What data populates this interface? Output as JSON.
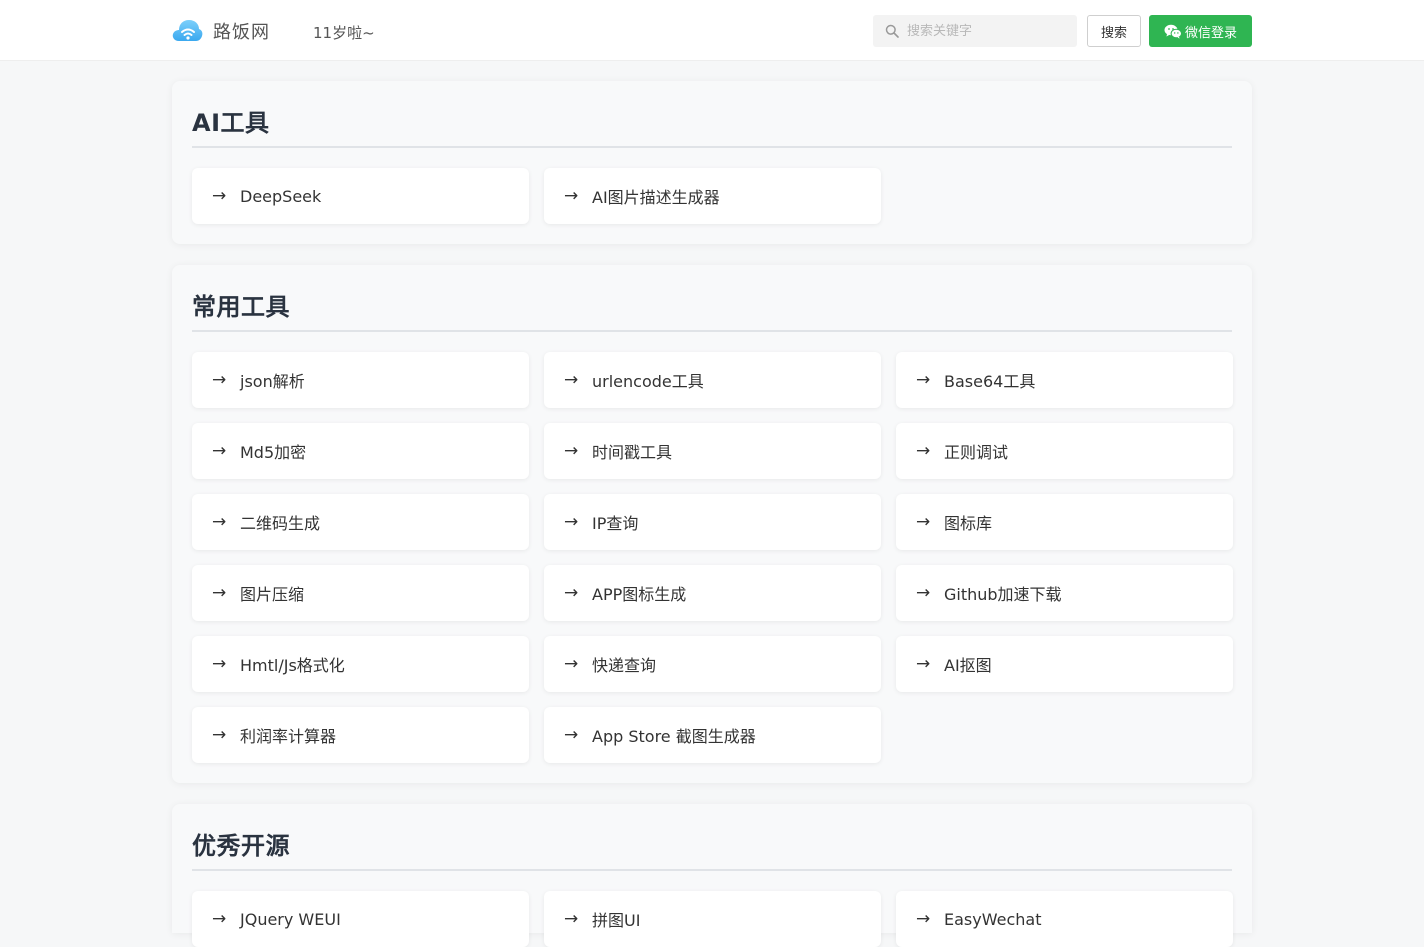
{
  "header": {
    "logo_text": "路饭网",
    "tagline": "11岁啦~",
    "search": {
      "placeholder": "搜索关键字",
      "value": ""
    },
    "search_button": "搜索",
    "login_button": "微信登录"
  },
  "colors": {
    "accent_green": "#2fb552",
    "logo_blue": "#4fb6f5",
    "page_bg": "#f6f7f8",
    "card_bg": "#ffffff",
    "heading": "#2a3340"
  },
  "icons": {
    "logo": "cloud-wifi-icon",
    "search": "search-icon",
    "login": "wechat-icon",
    "card": "arrow-right-icon"
  },
  "sections": [
    {
      "title": "AI工具",
      "items": [
        "DeepSeek",
        "AI图片描述生成器"
      ]
    },
    {
      "title": "常用工具",
      "items": [
        "json解析",
        "urlencode工具",
        "Base64工具",
        "Md5加密",
        "时间戳工具",
        "正则调试",
        "二维码生成",
        "IP查询",
        "图标库",
        "图片压缩",
        "APP图标生成",
        "Github加速下载",
        "Hmtl/Js格式化",
        "快递查询",
        "AI抠图",
        "利润率计算器",
        "App Store 截图生成器"
      ]
    },
    {
      "title": "优秀开源",
      "items": [
        "JQuery WEUI",
        "拼图UI",
        "EasyWechat"
      ]
    }
  ],
  "arrow_glyph": "→"
}
